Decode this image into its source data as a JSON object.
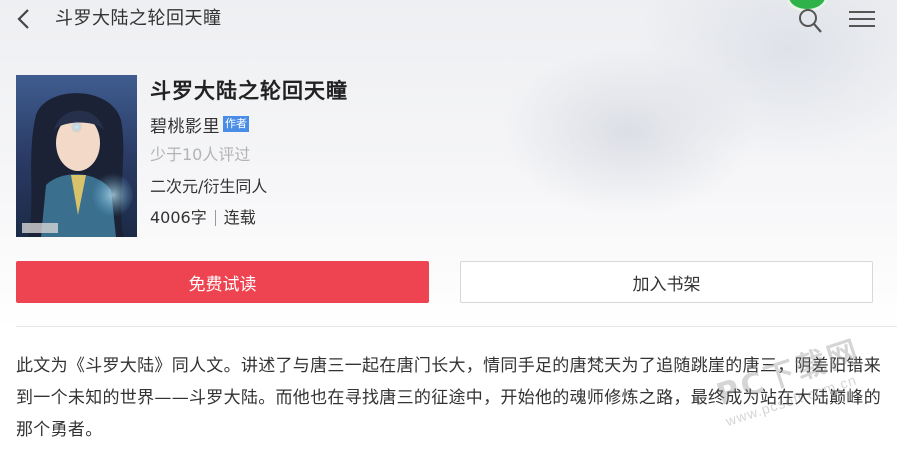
{
  "header": {
    "title": "斗罗大陆之轮回天瞳"
  },
  "book": {
    "title": "斗罗大陆之轮回天瞳",
    "author": "碧桃影里",
    "author_badge": "作者",
    "rating_text": "少于10人评过",
    "category": "二次元/衍生同人",
    "word_count": "4006字",
    "status": "连载"
  },
  "actions": {
    "read_label": "免费试读",
    "shelf_label": "加入书架"
  },
  "description": "此文为《斗罗大陆》同人文。讲述了与唐三一起在唐门长大，情同手足的唐梵天为了追随跳崖的唐三，阴差阳错来到一个未知的世界——斗罗大陆。而他也在寻找唐三的征途中，开始他的魂师修炼之路，最终成为站在大陆巅峰的那个勇者。",
  "watermark": {
    "main": "PC下载网",
    "sub": "www.pcsoft.com.cn"
  },
  "colors": {
    "primary_button": "#ee4350",
    "badge": "#4a8de6",
    "status_dot": "#2fb24a"
  }
}
